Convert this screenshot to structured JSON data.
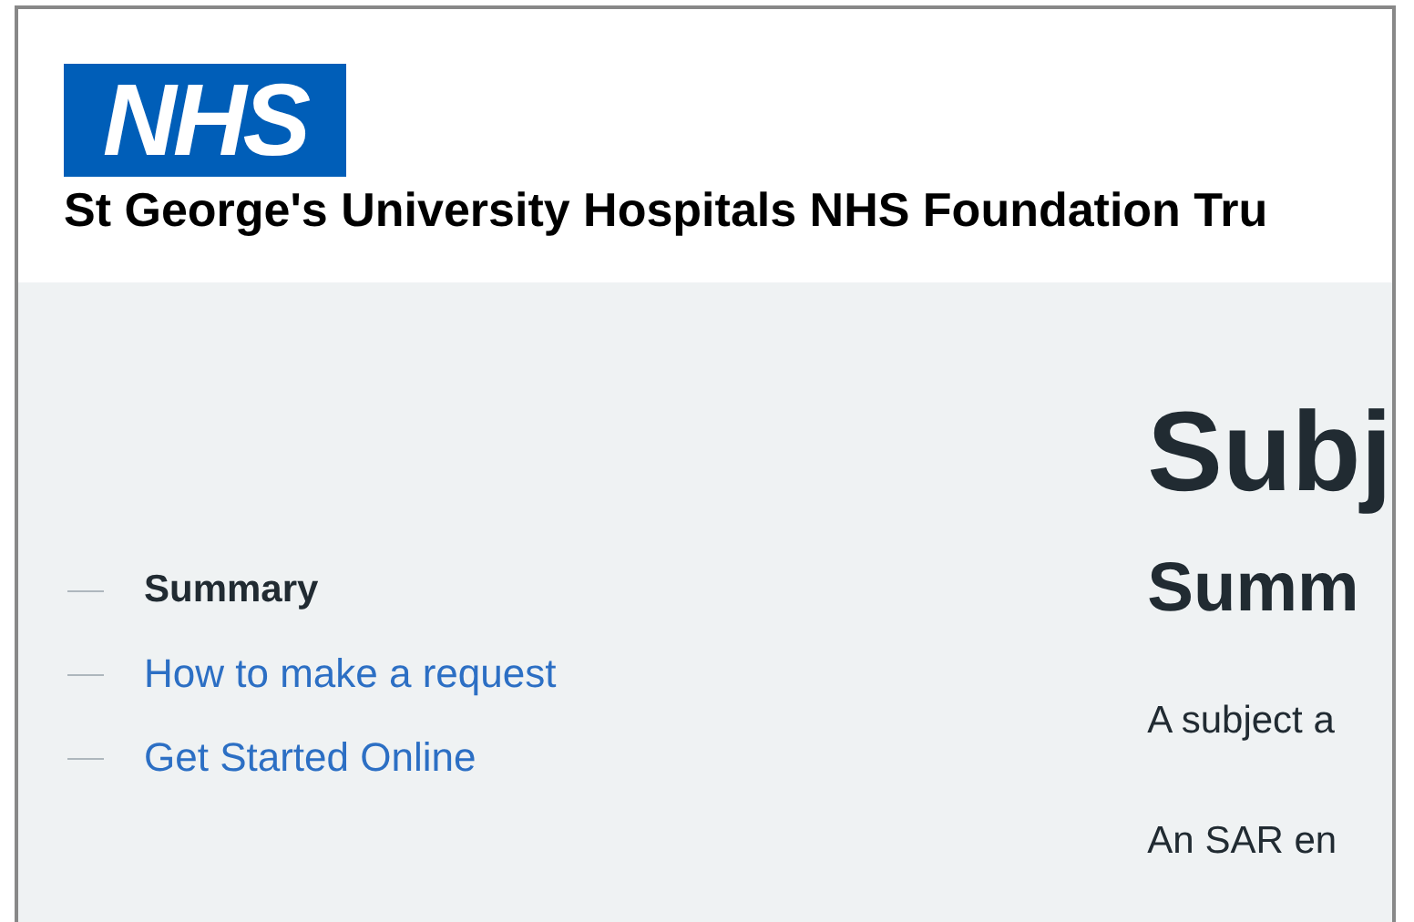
{
  "header": {
    "logo": "NHS",
    "organisation": "St George's University Hospitals NHS Foundation Tru"
  },
  "contents_nav": [
    {
      "label": "Summary",
      "selected": true
    },
    {
      "label": "How to make a request",
      "selected": false
    },
    {
      "label": "Get Started Online",
      "selected": false
    }
  ],
  "main": {
    "title": "Subj",
    "section_heading": "Summ",
    "paragraphs": [
      "A subject a",
      "An SAR en"
    ]
  }
}
